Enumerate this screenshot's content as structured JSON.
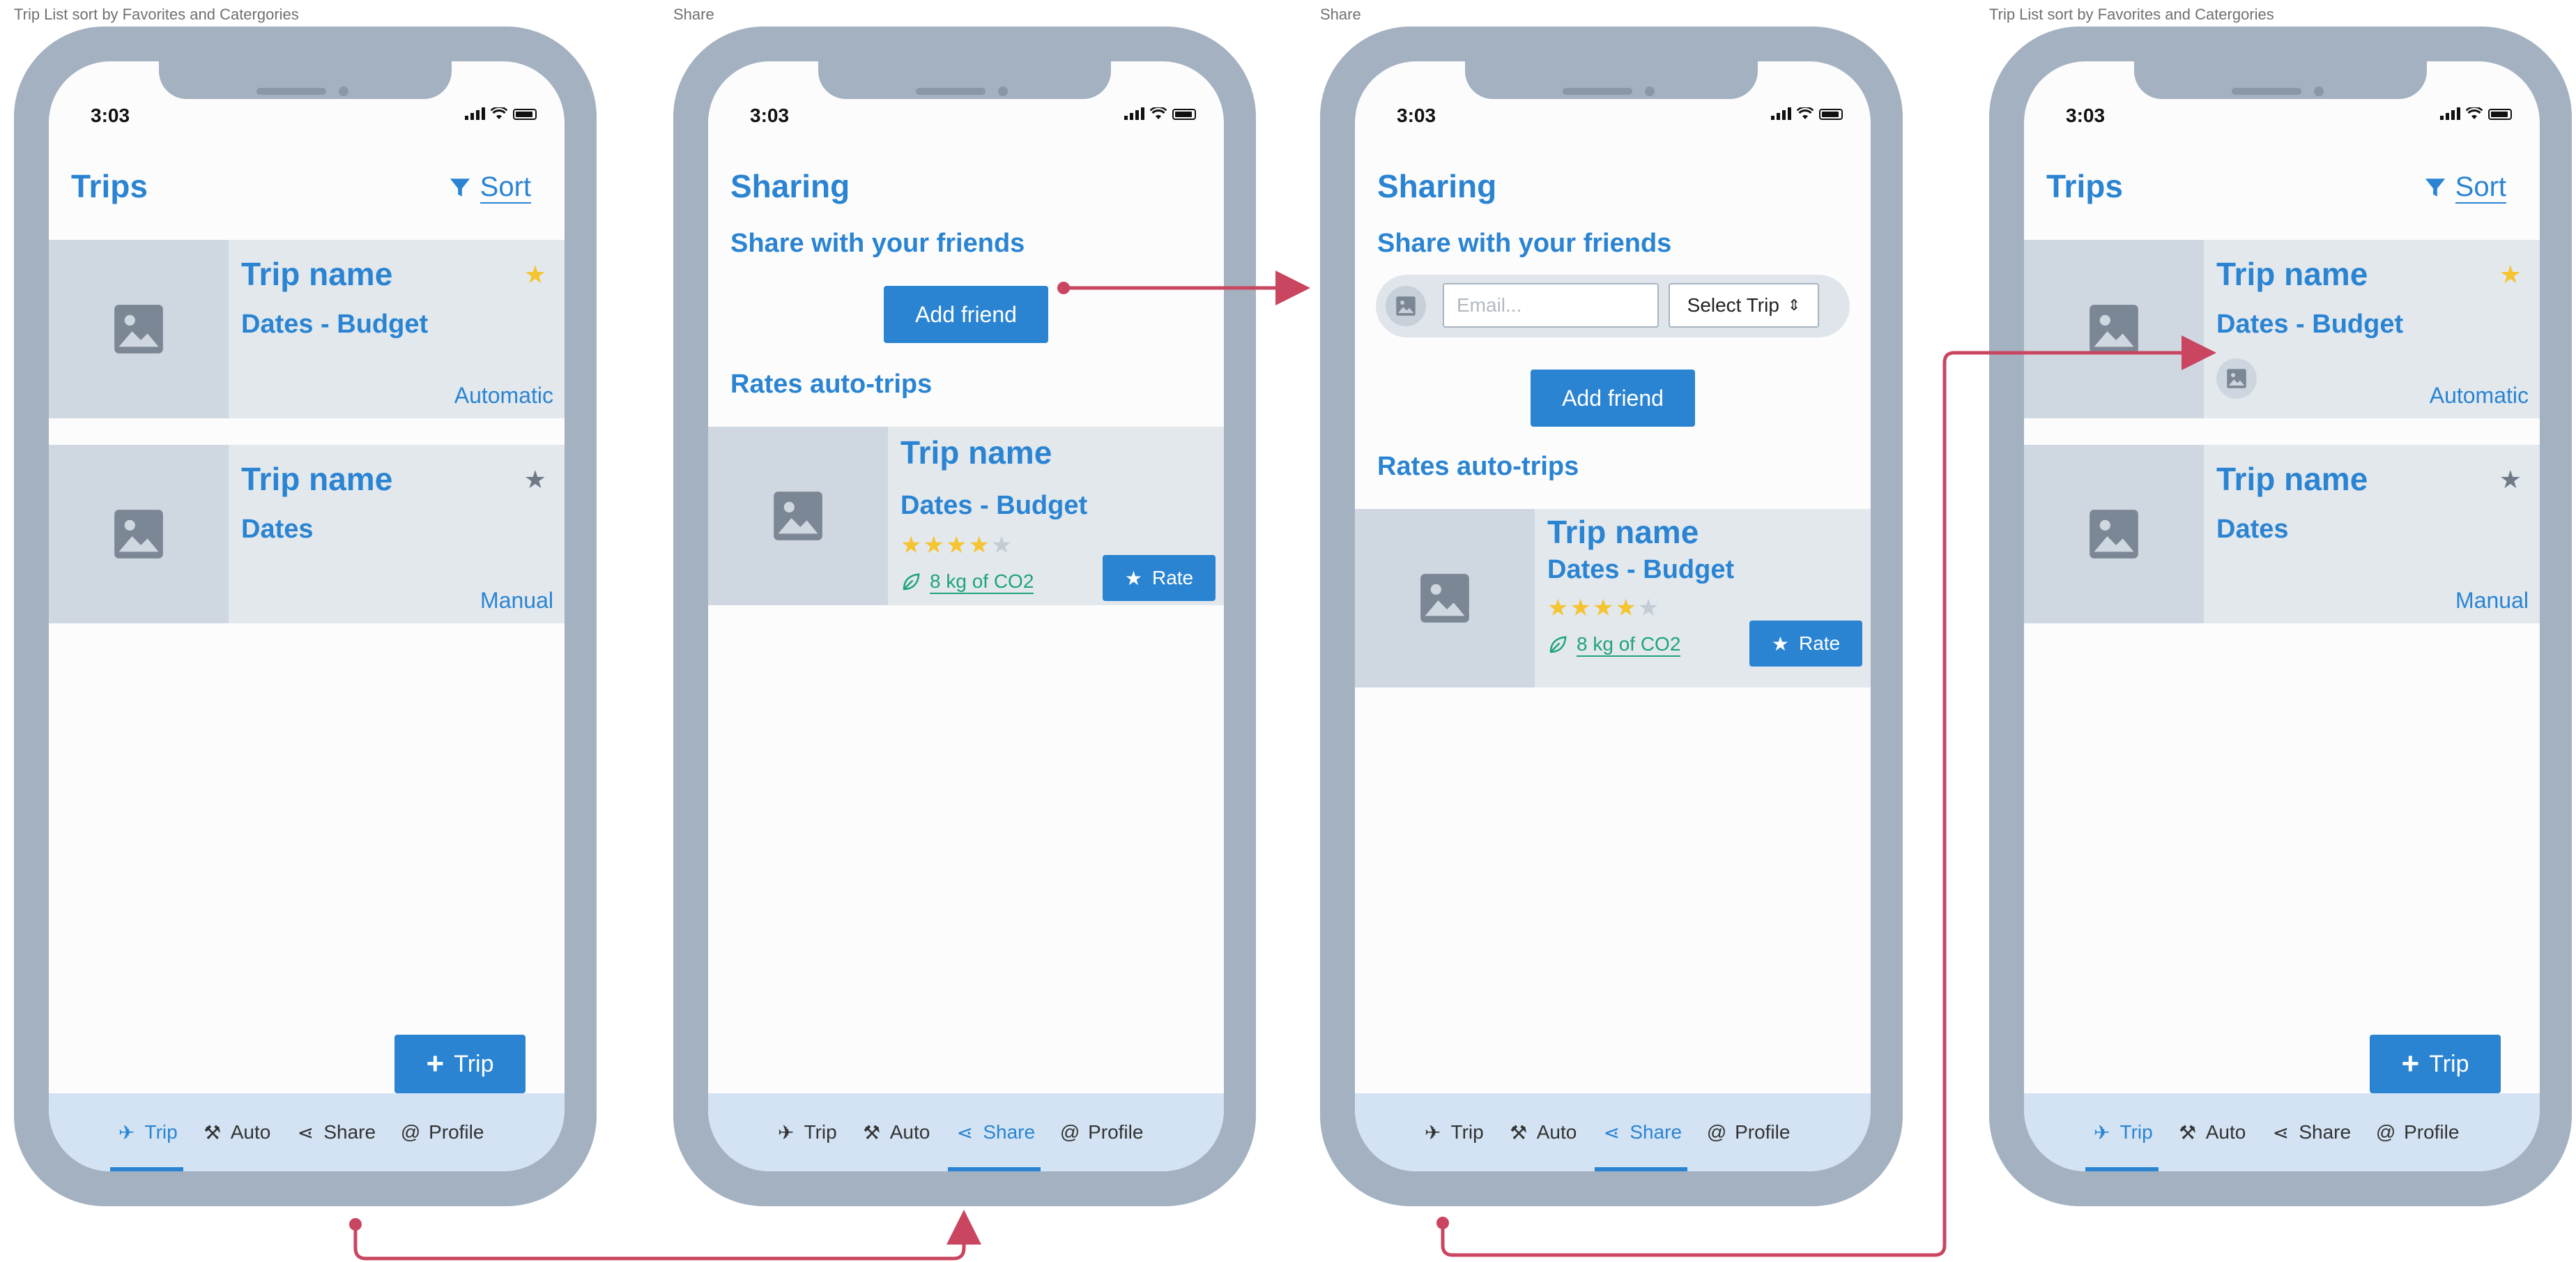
{
  "captions": {
    "screen1": "Trip List sort by Favorites and Catergories",
    "screen2": "Share",
    "screen3": "Share",
    "screen4": "Trip List sort by Favorites and Catergories"
  },
  "status": {
    "time": "3:03"
  },
  "trips_screen": {
    "title": "Trips",
    "sort_label": "Sort",
    "add_button": "Trip",
    "cards": [
      {
        "name": "Trip name",
        "dates": "Dates - Budget",
        "category": "Automatic",
        "favorite": true
      },
      {
        "name": "Trip name",
        "dates": "Dates",
        "category": "Manual",
        "favorite": false
      }
    ]
  },
  "share_screen": {
    "title": "Sharing",
    "subtitle": "Share with your friends",
    "add_friend": "Add friend",
    "rates_heading": "Rates auto-trips",
    "email_placeholder": "Email...",
    "select_trip": "Select Trip",
    "rate_card": {
      "name": "Trip name",
      "dates": "Dates - Budget",
      "rating": 4,
      "rating_max": 5,
      "co2": "8 kg of CO2",
      "rate_button": "Rate"
    }
  },
  "tabs": [
    "Trip",
    "Auto",
    "Share",
    "Profile"
  ],
  "colors": {
    "accent": "#2a84d2",
    "frame": "#a3b1c0",
    "arrow": "#c94560",
    "star": "#f5c431",
    "eco": "#1fa37c"
  },
  "icons": {
    "tab_trip": "airplane-icon",
    "tab_auto": "tools-icon",
    "tab_share": "share-icon",
    "tab_profile": "at-icon"
  }
}
